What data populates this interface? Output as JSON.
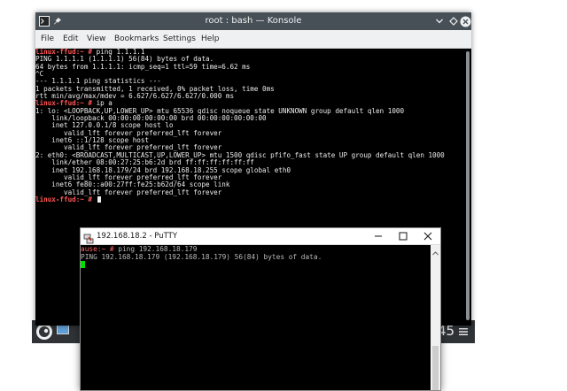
{
  "konsole": {
    "title": "root : bash — Konsole",
    "menu": [
      "File",
      "Edit",
      "View",
      "Bookmarks",
      "Settings",
      "Help"
    ],
    "lines": [
      {
        "prompt": "linux-ffud:~ #",
        "text": " ping 1.1.1.1"
      },
      {
        "prompt": "",
        "text": "PING 1.1.1.1 (1.1.1.1) 56(84) bytes of data."
      },
      {
        "prompt": "",
        "text": "64 bytes from 1.1.1.1: icmp_seq=1 ttl=59 time=6.62 ms"
      },
      {
        "prompt": "",
        "text": "^C"
      },
      {
        "prompt": "",
        "text": "--- 1.1.1.1 ping statistics ---"
      },
      {
        "prompt": "",
        "text": "1 packets transmitted, 1 received, 0% packet loss, time 0ms"
      },
      {
        "prompt": "",
        "text": "rtt min/avg/max/mdev = 6.627/6.627/6.627/0.000 ms"
      },
      {
        "prompt": "linux-ffud:~ #",
        "text": " ip a"
      },
      {
        "prompt": "",
        "text": "1: lo: <LOOPBACK,UP,LOWER_UP> mtu 65536 qdisc noqueue state UNKNOWN group default qlen 1000"
      },
      {
        "prompt": "",
        "text": "    link/loopback 00:00:00:00:00:00 brd 00:00:00:00:00:00"
      },
      {
        "prompt": "",
        "text": "    inet 127.0.0.1/8 scope host lo"
      },
      {
        "prompt": "",
        "text": "       valid_lft forever preferred_lft forever"
      },
      {
        "prompt": "",
        "text": "    inet6 ::1/128 scope host"
      },
      {
        "prompt": "",
        "text": "       valid_lft forever preferred_lft forever"
      },
      {
        "prompt": "",
        "text": "2: eth0: <BROADCAST,MULTICAST,UP,LOWER_UP> mtu 1500 qdisc pfifo_fast state UP group default qlen 1000"
      },
      {
        "prompt": "",
        "text": "    link/ether 08:00:27:25:b6:2d brd ff:ff:ff:ff:ff:ff"
      },
      {
        "prompt": "",
        "text": "    inet 192.168.18.179/24 brd 192.168.18.255 scope global eth0"
      },
      {
        "prompt": "",
        "text": "       valid_lft forever preferred_lft forever"
      },
      {
        "prompt": "",
        "text": "    inet6 fe80::a00:27ff:fe25:b62d/64 scope link"
      },
      {
        "prompt": "",
        "text": "       valid_lft forever preferred_lft forever"
      },
      {
        "prompt": "linux-ffud:~ #",
        "text": " ",
        "cursor": true
      }
    ]
  },
  "taskbar": {
    "number_text": "45"
  },
  "putty": {
    "title": "192.168.18.2 - PuTTY",
    "lines": [
      {
        "prompt": "ause:~ #",
        "text": " ping 192.168.18.179"
      },
      {
        "prompt": "",
        "text": "PING 192.168.18.179 (192.168.18.179) 56(84) bytes of data."
      }
    ]
  },
  "colors": {
    "prompt_red": "#ff5555",
    "putty_cursor_green": "#00e000",
    "titlebar_dark": "#475057"
  }
}
